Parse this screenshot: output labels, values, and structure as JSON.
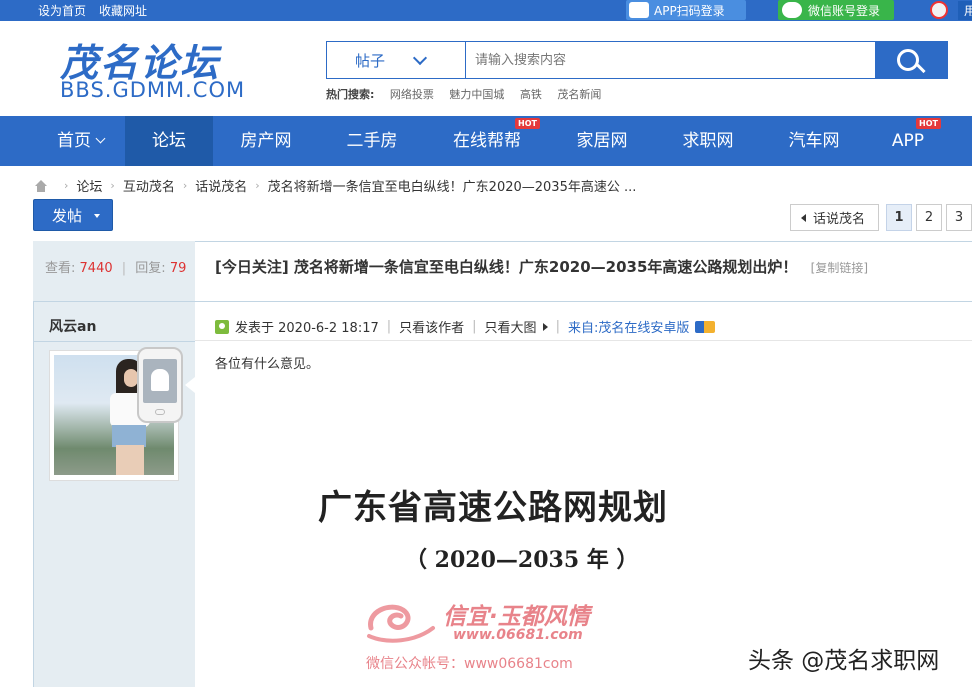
{
  "topbar": {
    "set_home": "设为首页",
    "bookmark": "收藏网址",
    "app_login": "APP扫码登录",
    "wechat_login": "微信账号登录",
    "user_fragment": "用"
  },
  "header": {
    "logo_text": "茂名论坛",
    "logo_domain": "BBS.GDMM.COM",
    "search": {
      "type_label": "帖子",
      "placeholder": "请输入搜索内容"
    },
    "hot_label": "热门搜索:",
    "hot_words": [
      "网络投票",
      "魅力中国城",
      "高铁",
      "茂名新闻"
    ]
  },
  "nav": {
    "items": [
      {
        "label": "首页"
      },
      {
        "label": "论坛"
      },
      {
        "label": "房产网"
      },
      {
        "label": "二手房"
      },
      {
        "label": "在线帮帮",
        "badge": "HOT"
      },
      {
        "label": "家居网"
      },
      {
        "label": "求职网"
      },
      {
        "label": "汽车网"
      },
      {
        "label": "APP",
        "badge": "HOT"
      }
    ]
  },
  "breadcrumb": [
    "论坛",
    "互动茂名",
    "话说茂名",
    "茂名将新增一条信宜至电白纵线！广东2020—2035年高速公 ..."
  ],
  "post_button": "发帖",
  "pager": {
    "back_label": "话说茂名",
    "pages": [
      "1",
      "2",
      "3"
    ],
    "current": "1"
  },
  "thread": {
    "views_label": "查看:",
    "views": "7440",
    "replies_label": "回复:",
    "replies": "79",
    "title": "[今日关注] 茂名将新增一条信宜至电白纵线！广东2020—2035年高速公路规划出炉！",
    "copy_link": "[复制链接]"
  },
  "post": {
    "author": "风云an",
    "posted_at": "发表于 2020-6-2 18:17",
    "only_author": "只看该作者",
    "only_images": "只看大图",
    "source": "来自:茂名在线安卓版",
    "body": "各位有什么意见。",
    "image": {
      "title": "广东省高速公路网规划",
      "subtitle": "（ 2020—2035 年 ）",
      "watermark_main": "信宜·玉都风情",
      "watermark_url": "www.06681.com",
      "watermark_line": "微信公众帐号：www06681com"
    }
  },
  "credit": "头条 @茂名求职网",
  "colors": {
    "brand_blue": "#2d6bc6",
    "nav_active": "#1f5aa8",
    "hot_red": "#e4393c",
    "count_red": "#dd3333",
    "watermark_pink": "#e8838a"
  }
}
